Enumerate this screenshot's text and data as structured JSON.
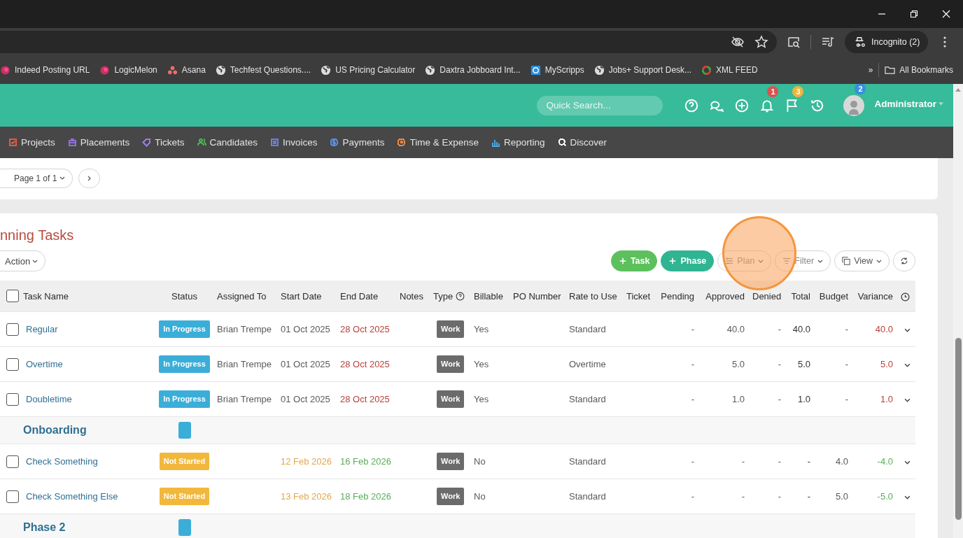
{
  "browser": {
    "incognito": "Incognito (2)"
  },
  "bookmarks": [
    {
      "label": "Indeed Posting URL",
      "kind": "fruit"
    },
    {
      "label": "LogicMelon",
      "kind": "fruit"
    },
    {
      "label": "Asana",
      "kind": "dots"
    },
    {
      "label": "Techfest Questions....",
      "kind": "globe"
    },
    {
      "label": "US Pricing Calculator",
      "kind": "globe"
    },
    {
      "label": "Daxtra Jobboard Int...",
      "kind": "globe"
    },
    {
      "label": "MyScripps",
      "kind": "square"
    },
    {
      "label": "Jobs+ Support Desk...",
      "kind": "globe"
    },
    {
      "label": "XML FEED",
      "kind": "ring"
    }
  ],
  "bookmarks_overflow": "»",
  "all_bookmarks": "All Bookmarks",
  "header": {
    "search": {
      "placeholder": "Quick Search..."
    },
    "notifications": "1",
    "flags": "3",
    "avatar_badge": "2",
    "user": "Administrator"
  },
  "nav": [
    {
      "label": "Projects",
      "kind": "check",
      "color": "#e05a47"
    },
    {
      "label": "Placements",
      "kind": "case",
      "color": "#8f6fd8"
    },
    {
      "label": "Tickets",
      "kind": "tag",
      "color": "#9b7be0"
    },
    {
      "label": "Candidates",
      "kind": "people",
      "color": "#4caf50"
    },
    {
      "label": "Invoices",
      "kind": "doc",
      "color": "#6c7fe0"
    },
    {
      "label": "Payments",
      "kind": "coin",
      "color": "#5a8de0"
    },
    {
      "label": "Time & Expense",
      "kind": "clock",
      "color": "#f0883e"
    },
    {
      "label": "Reporting",
      "kind": "bars",
      "color": "#4da3e0"
    },
    {
      "label": "Discover",
      "kind": "search",
      "color": "#ffffff"
    }
  ],
  "pager": {
    "label": "Page 1 of 1"
  },
  "tasks": {
    "title": "nning Tasks",
    "action": "Action",
    "buttons": [
      {
        "label": "Task",
        "kind": "add"
      },
      {
        "label": "Phase",
        "kind": "add_alt"
      },
      {
        "label": "Plan",
        "kind": "plan"
      },
      {
        "label": "Filter",
        "kind": "filter"
      },
      {
        "label": "View",
        "kind": "view"
      }
    ]
  },
  "table": {
    "header_checked": false,
    "columns": [
      "Task Name",
      "Status",
      "Assigned To",
      "Start Date",
      "End Date",
      "Notes",
      "Type",
      "Billable",
      "PO Number",
      "Rate to Use",
      "Ticket",
      "Pending",
      "Approved",
      "Denied",
      "Total",
      "Budget",
      "Variance"
    ],
    "rows": [
      {
        "kind": "task",
        "checked": false,
        "name": "Regular",
        "status": {
          "label": "In Progress",
          "kind": "in_progress"
        },
        "assigned": "Brian Trempe",
        "start": {
          "text": "01 Oct 2025",
          "color": "#5a5a5a"
        },
        "end": {
          "text": "28 Oct 2025",
          "color": "#b8403a"
        },
        "type": "Work",
        "billable": "Yes",
        "rate": "Standard",
        "pending": "-",
        "approved": "40.0",
        "denied": "-",
        "total": "40.0",
        "budget": "-",
        "variance": {
          "text": "40.0",
          "color": "#b8403a"
        }
      },
      {
        "kind": "task",
        "checked": false,
        "name": "Overtime",
        "status": {
          "label": "In Progress",
          "kind": "in_progress"
        },
        "assigned": "Brian Trempe",
        "start": {
          "text": "01 Oct 2025",
          "color": "#5a5a5a"
        },
        "end": {
          "text": "28 Oct 2025",
          "color": "#b8403a"
        },
        "type": "Work",
        "billable": "Yes",
        "rate": "Overtime",
        "pending": "-",
        "approved": "5.0",
        "denied": "-",
        "total": "5.0",
        "budget": "-",
        "variance": {
          "text": "5.0",
          "color": "#b8403a"
        }
      },
      {
        "kind": "task",
        "checked": false,
        "name": "Doubletime",
        "status": {
          "label": "In Progress",
          "kind": "in_progress"
        },
        "assigned": "Brian Trempe",
        "start": {
          "text": "01 Oct 2025",
          "color": "#5a5a5a"
        },
        "end": {
          "text": "28 Oct 2025",
          "color": "#b8403a"
        },
        "type": "Work",
        "billable": "Yes",
        "rate": "Standard",
        "pending": "-",
        "approved": "1.0",
        "denied": "-",
        "total": "1.0",
        "budget": "-",
        "variance": {
          "text": "1.0",
          "color": "#b8403a"
        }
      },
      {
        "kind": "phase",
        "name": "Onboarding",
        "color": "#3aaed8"
      },
      {
        "kind": "task",
        "checked": false,
        "name": "Check Something",
        "status": {
          "label": "Not Started",
          "kind": "not_started"
        },
        "assigned": "",
        "start": {
          "text": "12 Feb 2026",
          "color": "#e0a850"
        },
        "end": {
          "text": "16 Feb 2026",
          "color": "#5aad5a"
        },
        "type": "Work",
        "billable": "No",
        "rate": "Standard",
        "pending": "-",
        "approved": "-",
        "denied": "-",
        "total": "-",
        "budget": "4.0",
        "variance": {
          "text": "-4.0",
          "color": "#5aad5a"
        }
      },
      {
        "kind": "task",
        "checked": false,
        "name": "Check Something Else",
        "status": {
          "label": "Not Started",
          "kind": "not_started"
        },
        "assigned": "",
        "start": {
          "text": "13 Feb 2026",
          "color": "#e0a850"
        },
        "end": {
          "text": "18 Feb 2026",
          "color": "#5aad5a"
        },
        "type": "Work",
        "billable": "No",
        "rate": "Standard",
        "pending": "-",
        "approved": "-",
        "denied": "-",
        "total": "-",
        "budget": "5.0",
        "variance": {
          "text": "-5.0",
          "color": "#5aad5a"
        }
      },
      {
        "kind": "phase",
        "name": "Phase 2",
        "color": "#3aaed8"
      }
    ]
  }
}
